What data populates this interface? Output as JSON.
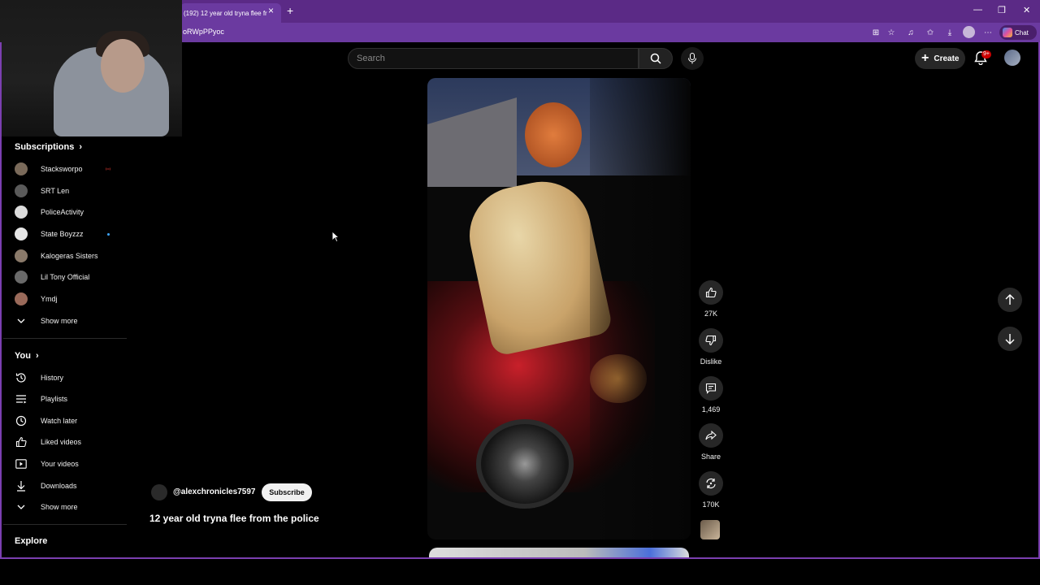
{
  "browser": {
    "tab_title": "(192) 12 year old tryna flee fr",
    "url": "oRWpPPyoc",
    "chat_label": "Chat"
  },
  "topbar": {
    "search_placeholder": "Search",
    "create_label": "Create",
    "notification_badge": "9+"
  },
  "sidebar": {
    "subscriptions_heading": "Subscriptions",
    "subscriptions": [
      {
        "label": "Stacksworpo",
        "avatar_color": "#7a6a5a",
        "indicator": "live"
      },
      {
        "label": "SRT Len",
        "avatar_color": "#5a5a5a",
        "indicator": ""
      },
      {
        "label": "PoliceActivity",
        "avatar_color": "#dcdcdc",
        "indicator": ""
      },
      {
        "label": "State Boyzzz",
        "avatar_color": "#e6e6e6",
        "indicator": "dot"
      },
      {
        "label": "Kalogeras Sisters",
        "avatar_color": "#8a7a6a",
        "indicator": ""
      },
      {
        "label": "Lil Tony Official",
        "avatar_color": "#6a6a6a",
        "indicator": ""
      },
      {
        "label": "Ymdj",
        "avatar_color": "#9a6a5a",
        "indicator": ""
      }
    ],
    "show_more_1": "Show more",
    "you_heading": "You",
    "you_items": [
      {
        "label": "History",
        "icon": "history-icon"
      },
      {
        "label": "Playlists",
        "icon": "playlists-icon"
      },
      {
        "label": "Watch later",
        "icon": "clock-icon"
      },
      {
        "label": "Liked videos",
        "icon": "thumbs-up-icon"
      },
      {
        "label": "Your videos",
        "icon": "video-icon"
      },
      {
        "label": "Downloads",
        "icon": "download-icon"
      }
    ],
    "show_more_2": "Show more",
    "explore_heading": "Explore"
  },
  "video": {
    "channel_handle": "@alexchronicles7597",
    "subscribe_label": "Subscribe",
    "title": "12 year old tryna flee from the police"
  },
  "actions": {
    "likes": "27K",
    "dislike_label": "Dislike",
    "comments": "1,469",
    "share_label": "Share",
    "remix": "170K"
  },
  "colors": {
    "browser_frame": "#5b2a86",
    "accent_red": "#cc0000"
  }
}
